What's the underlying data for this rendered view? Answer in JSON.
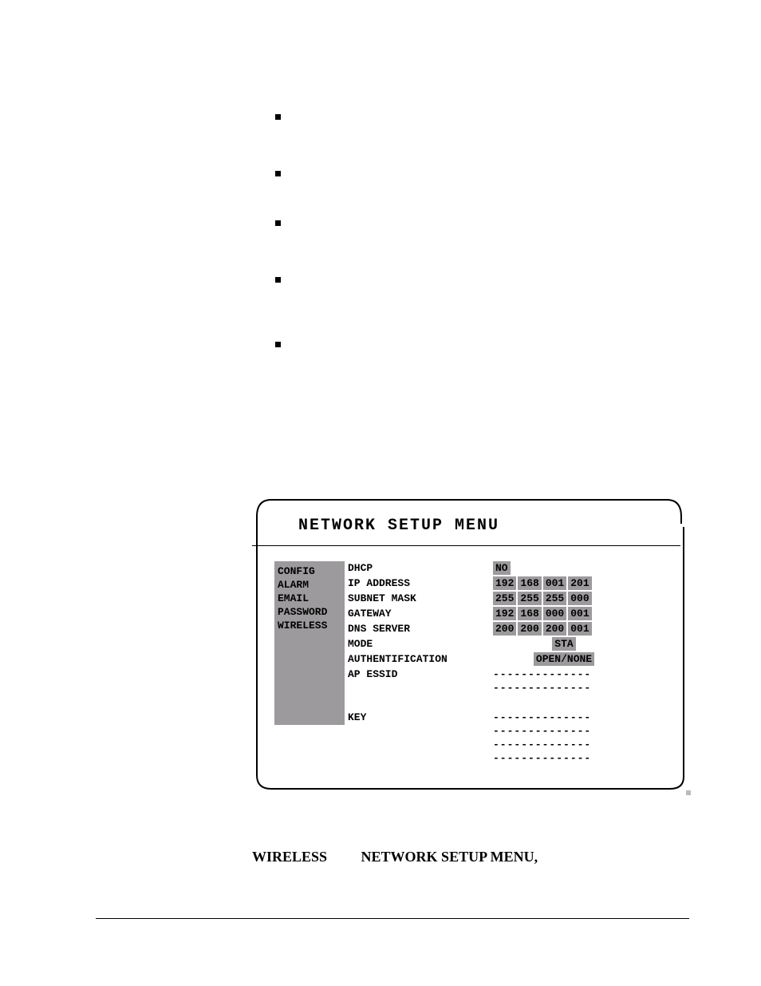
{
  "panel": {
    "title": "NETWORK SETUP MENU",
    "sidebar": {
      "items": [
        {
          "label": "CONFIG"
        },
        {
          "label": "ALARM"
        },
        {
          "label": "EMAIL"
        },
        {
          "label": "PASSWORD"
        },
        {
          "label": "WIRELESS"
        }
      ]
    },
    "fields": {
      "dhcp_label": "DHCP",
      "dhcp_value": "NO",
      "ip_label": "IP ADDRESS",
      "ip": {
        "o1": "192",
        "o2": "168",
        "o3": "001",
        "o4": "201"
      },
      "mask_label": "SUBNET MASK",
      "mask": {
        "o1": "255",
        "o2": "255",
        "o3": "255",
        "o4": "000"
      },
      "gw_label": "GATEWAY",
      "gw": {
        "o1": "192",
        "o2": "168",
        "o3": "000",
        "o4": "001"
      },
      "dns_label": "DNS SERVER",
      "dns": {
        "o1": "200",
        "o2": "200",
        "o3": "200",
        "o4": "001"
      },
      "mode_label": "MODE",
      "mode_value": "STA",
      "auth_label": "AUTHENTIFICATION",
      "auth_value": "OPEN/NONE",
      "essid_label": "AP ESSID",
      "essid_dash1": "--------------",
      "essid_dash2": "--------------",
      "key_label": "KEY",
      "key_dash1": "--------------",
      "key_dash2": "--------------",
      "key_dash3": "--------------",
      "key_dash4": "--------------"
    }
  },
  "section": {
    "term": "WIRELESS",
    "heading": "NETWORK SETUP MENU,"
  }
}
